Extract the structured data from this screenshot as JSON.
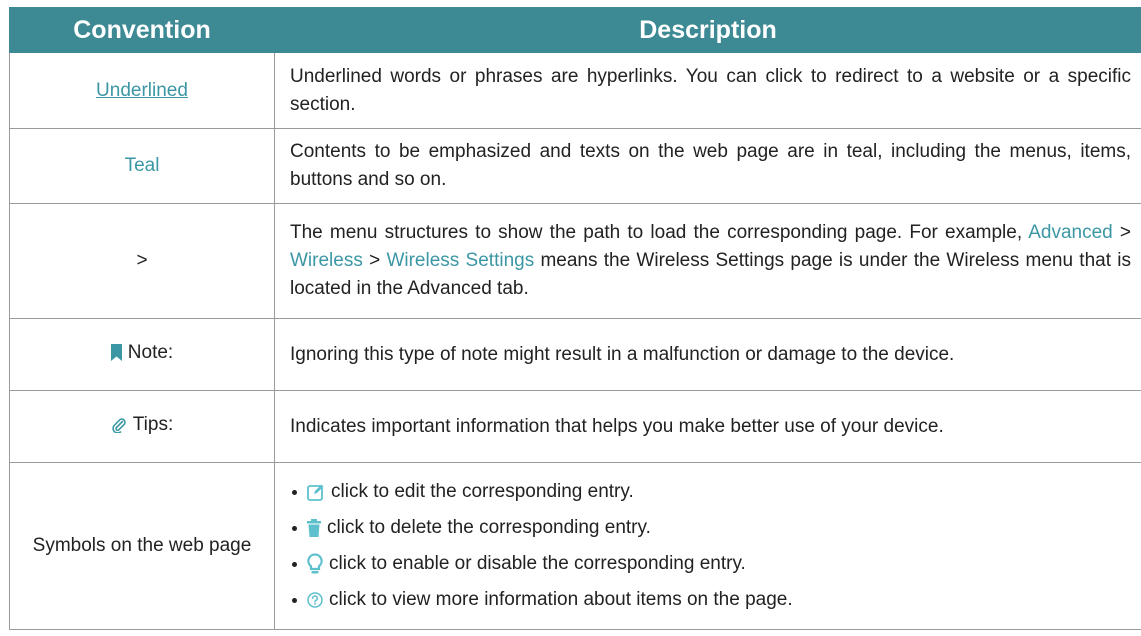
{
  "header": {
    "convention": "Convention",
    "description": "Description"
  },
  "rows": {
    "underlined": {
      "convention": "Underlined",
      "description": "Underlined words or phrases are hyperlinks. You can click to redirect to a website or a specific section."
    },
    "teal": {
      "convention": "Teal",
      "description": "Contents to be emphasized and texts on the web page are in teal, including the menus, items, buttons and so on."
    },
    "arrow": {
      "convention": ">",
      "description_prefix": "The menu structures to show the path to load the corresponding page. For example, ",
      "path1": "Advanced",
      "sep1": " > ",
      "path2": "Wireless",
      "sep2": " > ",
      "path3": "Wireless Settings",
      "description_suffix": " means the Wireless Settings page is under the Wireless menu that is located in the Advanced tab."
    },
    "note": {
      "convention": "Note:",
      "icon": "bookmark-icon",
      "description": "Ignoring this type of note might result in a malfunction or damage to the device."
    },
    "tips": {
      "convention": "Tips:",
      "icon": "paperclip-icon",
      "description": "Indicates important information that helps you make better use of your device."
    },
    "symbols": {
      "convention": "Symbols on the web page",
      "items": [
        {
          "icon": "edit-icon",
          "text": "click to edit the corresponding entry."
        },
        {
          "icon": "trash-icon",
          "text": "click to delete the corresponding entry."
        },
        {
          "icon": "lightbulb-icon",
          "text": "click to enable or disable the corresponding entry."
        },
        {
          "icon": "help-icon",
          "text": "click to view more information about items on the page."
        }
      ]
    }
  },
  "colors": {
    "header_bg": "#3d8a95",
    "teal": "#3c97a4",
    "border": "#9a9a9a"
  }
}
